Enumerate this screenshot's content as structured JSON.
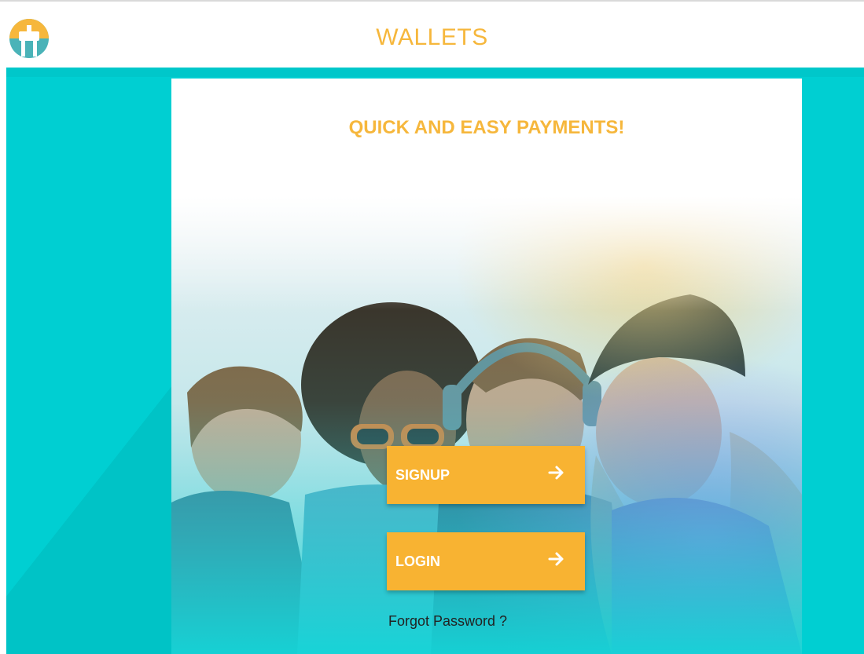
{
  "header": {
    "title": "WALLETS",
    "logo_icon": "wallet-logo-icon"
  },
  "card": {
    "headline": "QUICK AND EASY PAYMENTS!",
    "hero_image": "group-of-friends-selfie-photo"
  },
  "actions": {
    "signup_label": "SIGNUP",
    "login_label": "LOGIN",
    "arrow_icon": "arrow-right-icon",
    "forgot_label": "Forgot Password ?"
  },
  "colors": {
    "brand_orange": "#f6b73c",
    "button_orange": "#f8b332",
    "background_teal": "#00cfd2",
    "card_white": "#ffffff"
  }
}
